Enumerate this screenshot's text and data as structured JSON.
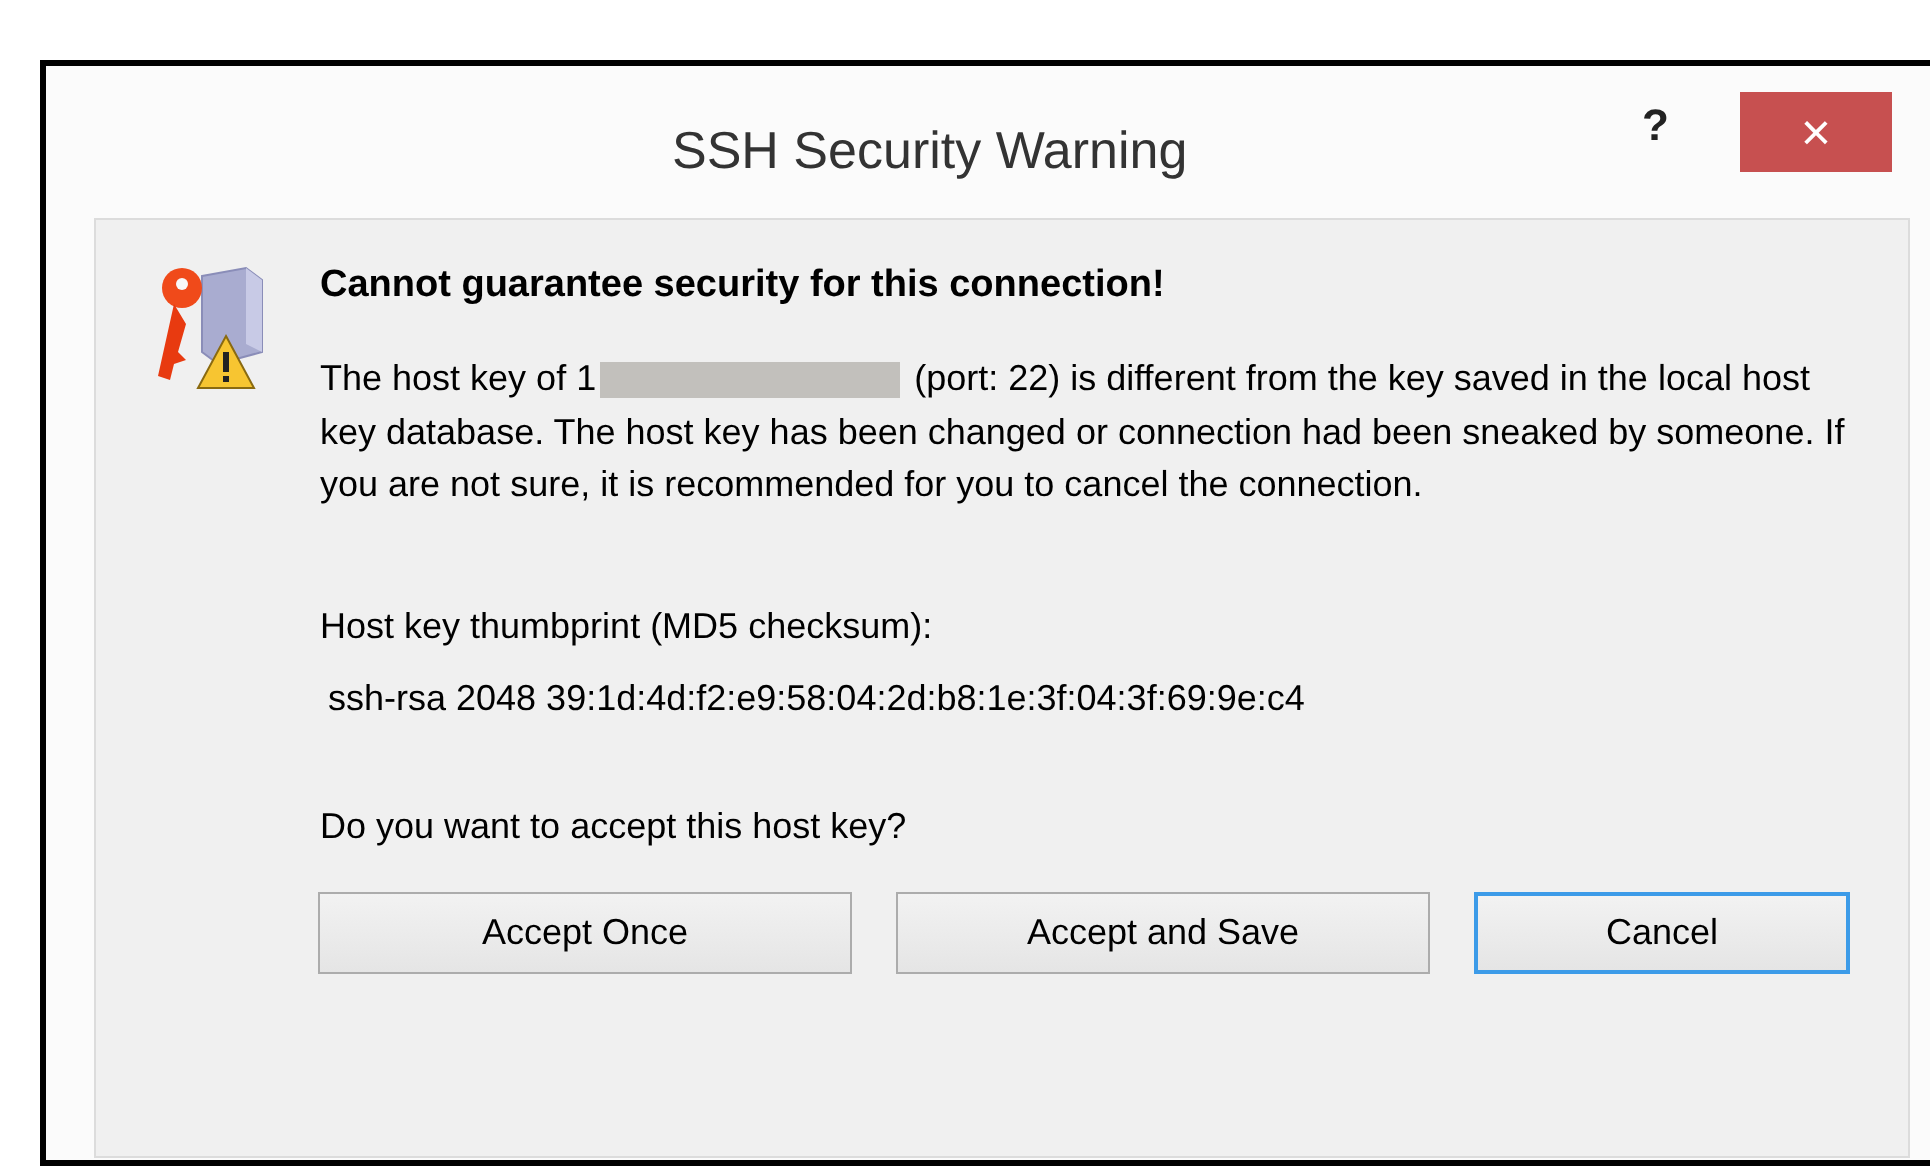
{
  "window": {
    "title": "SSH Security Warning",
    "help": "?",
    "close": "×"
  },
  "heading": "Cannot guarantee security for this connection!",
  "message": {
    "before": "The host key of 1",
    "after": "(port: 22) is different from the key saved in the local host key database. The host key has been changed or connection had been sneaked by someone. If you are not sure, it is recommended for you to cancel the connection."
  },
  "thumbprint_label": "Host key thumbprint (MD5 checksum):",
  "thumbprint": "ssh-rsa 2048 39:1d:4d:f2:e9:58:04:2d:b8:1e:3f:04:3f:69:9e:c4",
  "question": "Do you want to accept this host key?",
  "buttons": [
    {
      "label": "Accept Once",
      "selected": false
    },
    {
      "label": "Accept and Save",
      "selected": false
    },
    {
      "label": "Cancel",
      "selected": true
    }
  ]
}
